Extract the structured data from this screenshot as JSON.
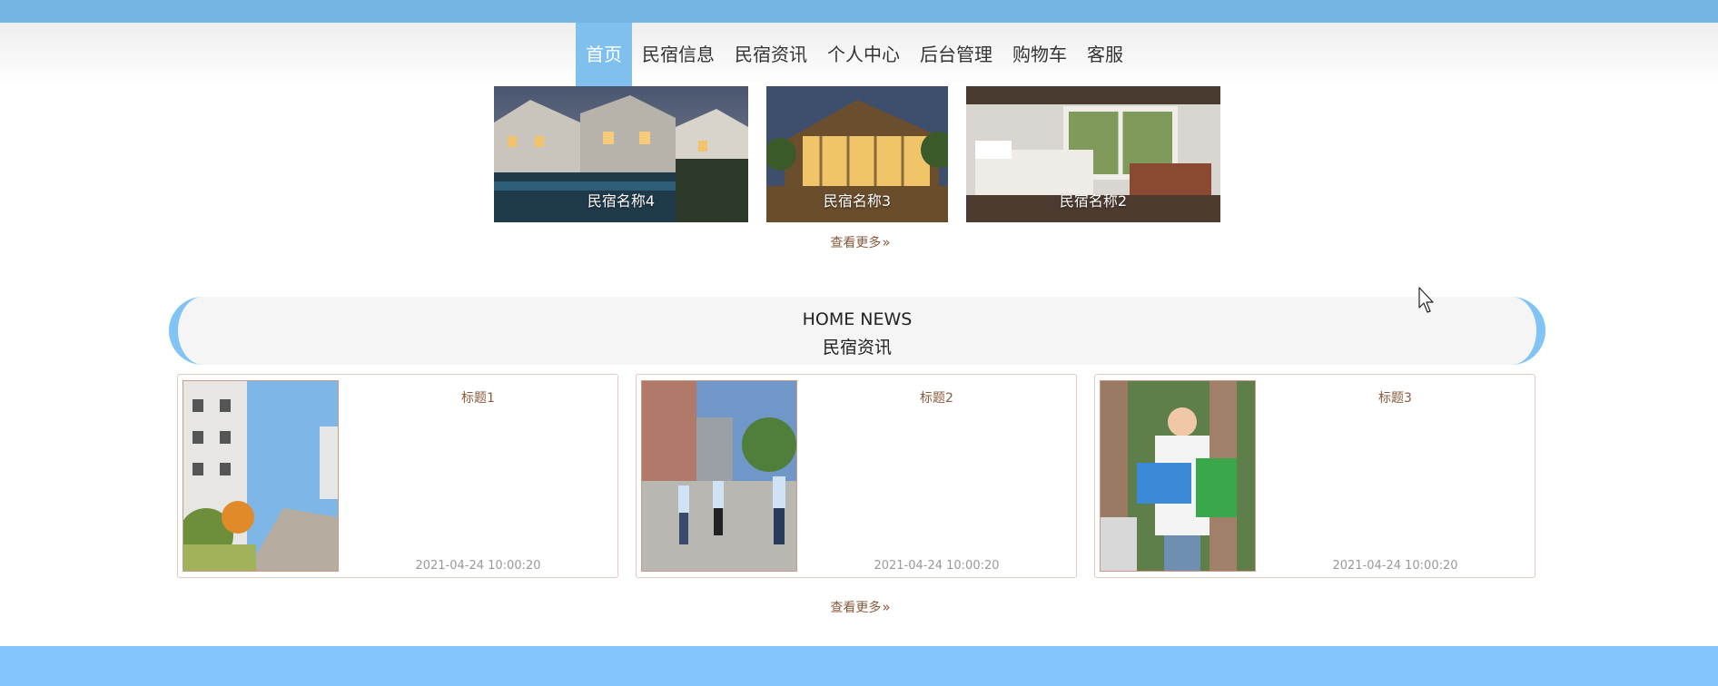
{
  "nav": {
    "items": [
      {
        "label": "首页",
        "active": true
      },
      {
        "label": "民宿信息",
        "active": false
      },
      {
        "label": "民宿资讯",
        "active": false
      },
      {
        "label": "个人中心",
        "active": false
      },
      {
        "label": "后台管理",
        "active": false
      },
      {
        "label": "购物车",
        "active": false
      },
      {
        "label": "客服",
        "active": false
      }
    ]
  },
  "houses": {
    "items": [
      {
        "name": "民宿名称4"
      },
      {
        "name": "民宿名称3"
      },
      {
        "name": "民宿名称2"
      }
    ],
    "more_label": "查看更多",
    "more_icon": "»"
  },
  "news": {
    "heading_en": "HOME NEWS",
    "heading_zh": "民宿资讯",
    "items": [
      {
        "title": "标题1",
        "date": "2021-04-24 10:00:20"
      },
      {
        "title": "标题2",
        "date": "2021-04-24 10:00:20"
      },
      {
        "title": "标题3",
        "date": "2021-04-24 10:00:20"
      }
    ],
    "more_label": "查看更多",
    "more_icon": "»"
  },
  "colors": {
    "top_bar": "#74b5e5",
    "nav_active": "#7fc0ee",
    "bottom_bar": "#84c6fb",
    "link_brown": "#8a5a3c"
  }
}
